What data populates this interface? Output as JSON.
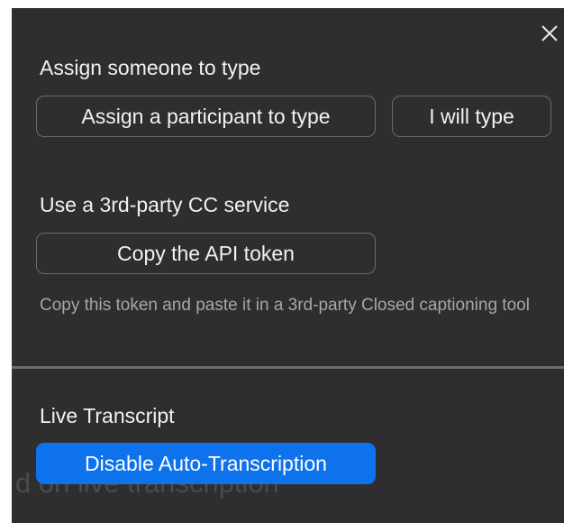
{
  "icons": {
    "close": "close-icon"
  },
  "assign": {
    "title": "Assign someone to type",
    "participant_button": "Assign a participant to type",
    "self_button": "I will type"
  },
  "third_party": {
    "title": "Use a 3rd-party CC service",
    "copy_button": "Copy the API token",
    "helper": "Copy this token and paste it in a 3rd-party Closed captioning tool"
  },
  "transcript": {
    "title": "Live Transcript",
    "disable_button": "Disable Auto-Transcription",
    "background_text": "d on live transcription"
  },
  "colors": {
    "panel_bg": "#2e2e30",
    "accent": "#0e72ed",
    "divider": "#6d6d70"
  }
}
